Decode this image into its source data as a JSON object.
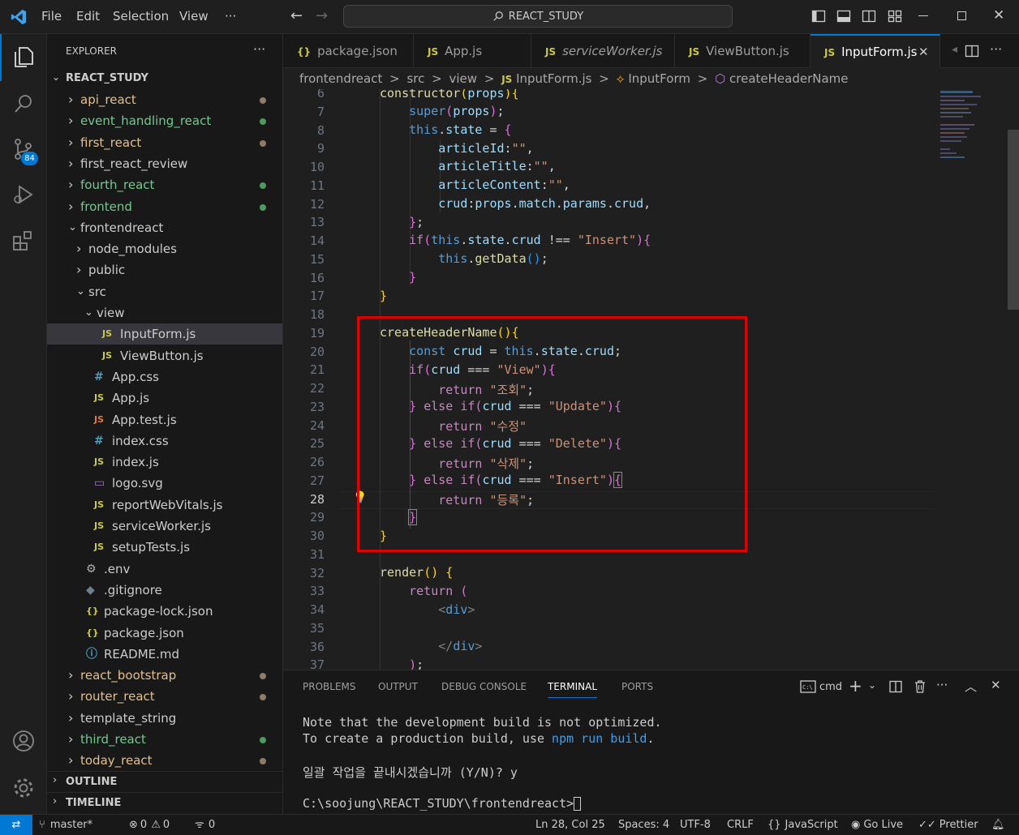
{
  "titlebar": {
    "menu": [
      "File",
      "Edit",
      "Selection",
      "View",
      "···"
    ],
    "search_text": "REACT_STUDY"
  },
  "activity": {
    "scm_badge": "84"
  },
  "sidebar": {
    "header": "EXPLORER",
    "more": "···",
    "root": "REACT_STUDY",
    "items": [
      {
        "label": "api_react",
        "type": "folder",
        "collapsed": true,
        "status": "modified"
      },
      {
        "label": "event_handling_react",
        "type": "folder",
        "collapsed": true,
        "status": "untracked"
      },
      {
        "label": "first_react",
        "type": "folder",
        "collapsed": true,
        "status": "modified"
      },
      {
        "label": "first_react_review",
        "type": "folder",
        "collapsed": true,
        "status": "none"
      },
      {
        "label": "fourth_react",
        "type": "folder",
        "collapsed": true,
        "status": "untracked"
      },
      {
        "label": "frontend",
        "type": "folder",
        "collapsed": true,
        "status": "untracked"
      },
      {
        "label": "frontendreact",
        "type": "folder",
        "collapsed": false,
        "status": "none"
      },
      {
        "label": "node_modules",
        "type": "folder",
        "collapsed": true,
        "status": "none"
      },
      {
        "label": "public",
        "type": "folder",
        "collapsed": true,
        "status": "none"
      },
      {
        "label": "src",
        "type": "folder",
        "collapsed": false,
        "status": "none"
      },
      {
        "label": "view",
        "type": "folder",
        "collapsed": false,
        "status": "none"
      },
      {
        "label": "InputForm.js",
        "type": "js",
        "status": "none"
      },
      {
        "label": "ViewButton.js",
        "type": "js",
        "status": "none"
      },
      {
        "label": "App.css",
        "type": "css",
        "status": "none"
      },
      {
        "label": "App.js",
        "type": "js",
        "status": "none"
      },
      {
        "label": "App.test.js",
        "type": "test",
        "status": "none"
      },
      {
        "label": "index.css",
        "type": "css",
        "status": "none"
      },
      {
        "label": "index.js",
        "type": "js",
        "status": "none"
      },
      {
        "label": "logo.svg",
        "type": "svg",
        "status": "none"
      },
      {
        "label": "reportWebVitals.js",
        "type": "js",
        "status": "none"
      },
      {
        "label": "serviceWorker.js",
        "type": "js",
        "status": "none"
      },
      {
        "label": "setupTests.js",
        "type": "js",
        "status": "none"
      },
      {
        "label": ".env",
        "type": "env",
        "status": "none"
      },
      {
        "label": ".gitignore",
        "type": "git",
        "status": "none"
      },
      {
        "label": "package-lock.json",
        "type": "json",
        "status": "none"
      },
      {
        "label": "package.json",
        "type": "json",
        "status": "none"
      },
      {
        "label": "README.md",
        "type": "info",
        "status": "none"
      },
      {
        "label": "react_bootstrap",
        "type": "folder",
        "collapsed": true,
        "status": "modified"
      },
      {
        "label": "router_react",
        "type": "folder",
        "collapsed": true,
        "status": "modified"
      },
      {
        "label": "template_string",
        "type": "folder",
        "collapsed": true,
        "status": "none"
      },
      {
        "label": "third_react",
        "type": "folder",
        "collapsed": true,
        "status": "untracked"
      },
      {
        "label": "today_react",
        "type": "folder",
        "collapsed": true,
        "status": "modified"
      }
    ],
    "outline": "OUTLINE",
    "timeline": "TIMELINE"
  },
  "tabs": [
    {
      "label": "package.json",
      "icon": "{}"
    },
    {
      "label": "App.js",
      "icon": "JS"
    },
    {
      "label": "serviceWorker.js",
      "icon": "JS"
    },
    {
      "label": "ViewButton.js",
      "icon": "JS"
    },
    {
      "label": "InputForm.js",
      "icon": "JS",
      "active": true
    }
  ],
  "breadcrumb": {
    "folder": "frontendreact",
    "sep": ">",
    "src": "src",
    "view": "view",
    "file": "InputForm.js",
    "class": "InputForm",
    "method": "createHeaderName"
  },
  "editor": {
    "line_numbers": [
      "6",
      "7",
      "8",
      "9",
      "10",
      "11",
      "12",
      "13",
      "14",
      "15",
      "16",
      "17",
      "18",
      "19",
      "20",
      "21",
      "22",
      "23",
      "24",
      "25",
      "26",
      "27",
      "28",
      "29",
      "30",
      "31",
      "32",
      "33",
      "34",
      "35",
      "36",
      "37"
    ],
    "current_line": "28",
    "highlight_color": "#e00000"
  },
  "panel": {
    "tabs": [
      "PROBLEMS",
      "OUTPUT",
      "DEBUG CONSOLE",
      "TERMINAL",
      "PORTS"
    ],
    "active_tab": "TERMINAL",
    "shell": "cmd",
    "terminal_lines": [
      "Note that the development build is not optimized.",
      "To create a production build, use npm run build.",
      "",
      "일괄 작업을 끝내시겠습니까 (Y/N)? y",
      "",
      "C:\\soojung\\REACT_STUDY\\frontendreact>"
    ],
    "npm_cmd": "npm run build"
  },
  "status": {
    "branch": "master*",
    "errors": "0",
    "warnings": "0",
    "ports": "0",
    "position": "Ln 28, Col 25",
    "spaces": "Spaces: 4",
    "encoding": "UTF-8",
    "eol": "CRLF",
    "language": "JavaScript",
    "golive": "Go Live",
    "prettier": "Prettier"
  },
  "colors": {
    "accent": "#0078d4",
    "modified_dot": "#8e7b6a",
    "untracked_dot": "#4e9a60",
    "folder_green": "#73c991"
  }
}
